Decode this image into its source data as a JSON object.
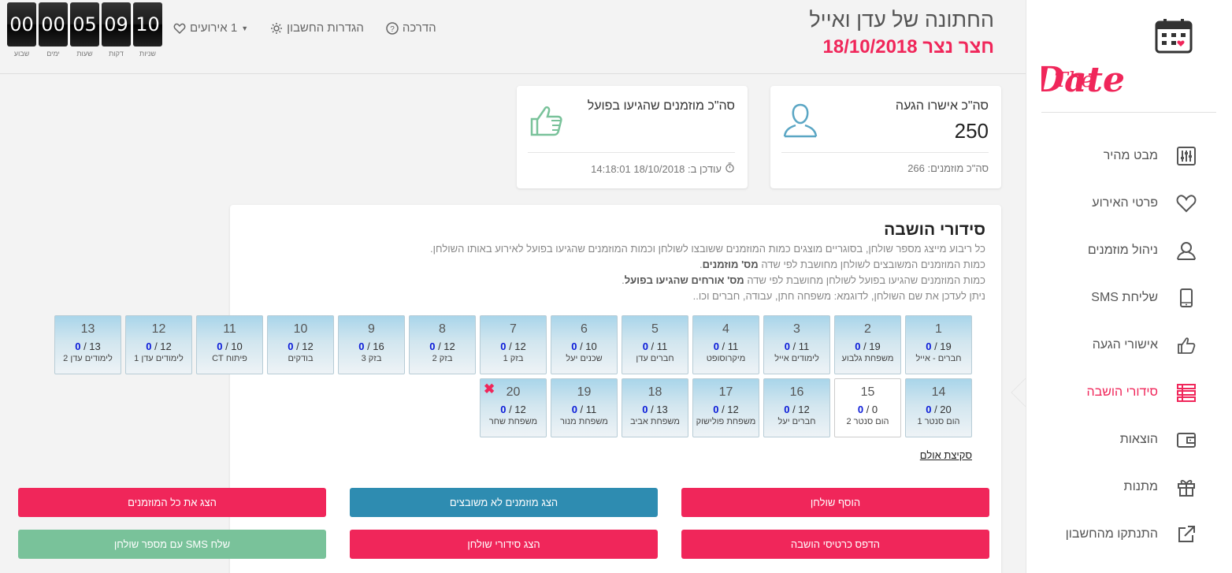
{
  "sidebar": {
    "logo_text": "Save The Date",
    "items": [
      {
        "label": "מבט מהיר",
        "icon": "sliders-icon"
      },
      {
        "label": "פרטי האירוע",
        "icon": "heart-icon"
      },
      {
        "label": "ניהול מוזמנים",
        "icon": "user-icon"
      },
      {
        "label": "שליחת SMS",
        "icon": "phone-icon"
      },
      {
        "label": "אישורי הגעה",
        "icon": "thumbs-up-icon"
      },
      {
        "label": "סידורי הושבה",
        "icon": "seating-icon",
        "active": true
      },
      {
        "label": "הוצאות",
        "icon": "wallet-icon"
      },
      {
        "label": "מתנות",
        "icon": "gift-icon"
      },
      {
        "label": "התנתקו מהחשבון",
        "icon": "external-link-icon"
      }
    ]
  },
  "header": {
    "title": "החתונה של עדן ואייל",
    "subtitle": "חצר נצר 18/10/2018",
    "nav": {
      "guide": "הדרכה",
      "settings": "הגדרות החשבון",
      "events": "1 אירועים"
    },
    "countdown": [
      {
        "value": "00",
        "label": "שבוע"
      },
      {
        "value": "00",
        "label": "ימים"
      },
      {
        "value": "05",
        "label": "שעות"
      },
      {
        "value": "09",
        "label": "דקות"
      },
      {
        "value": "10",
        "label": "שניות"
      }
    ]
  },
  "cards": {
    "rsvp": {
      "title": "סה\"כ אישרו הגעה",
      "value": "250",
      "footer": "סה\"כ מוזמנים: 266"
    },
    "arrived": {
      "title": "סה\"כ מוזמנים שהגיעו בפועל",
      "value": "",
      "footer": "עודכן ב: 18/10/2018 14:18:01"
    }
  },
  "panel": {
    "title": "סידורי הושבה",
    "desc1": "כל ריבוע מייצג מספר שולחן, בסוגריים מוצגים כמות המוזמנים ששובצו לשולחן וכמות המוזמנים שהגיעו בפועל לאירוע באותו השולחן.",
    "desc2_pre": "כמות המוזמנים המשובצים לשולחן מחושבת לפי שדה ",
    "desc2_bold": "מס' מוזמנים",
    "desc2_post": ".",
    "desc3_pre": "כמות המוזמנים שהגיעו בפועל לשולחן מחושבת לפי שדה ",
    "desc3_bold": "מס' אורחים שהגיעו בפועל",
    "desc3_post": ".",
    "desc4": "ניתן לעדכן את שם השולחן, לדוגמא: משפחה חתן, עבודה, חברים וכו..",
    "floorplan": "סקיצת אולם"
  },
  "tables_row1": [
    {
      "num": "1",
      "arrived": "0",
      "seated": "19",
      "name": "חברים - אייל"
    },
    {
      "num": "2",
      "arrived": "0",
      "seated": "19",
      "name": "משפחת גלבוע"
    },
    {
      "num": "3",
      "arrived": "0",
      "seated": "11",
      "name": "לימודים אייל"
    },
    {
      "num": "4",
      "arrived": "0",
      "seated": "11",
      "name": "מיקרוסופט"
    },
    {
      "num": "5",
      "arrived": "0",
      "seated": "11",
      "name": "חברים עדן"
    },
    {
      "num": "6",
      "arrived": "0",
      "seated": "10",
      "name": "שכנים יעל"
    },
    {
      "num": "7",
      "arrived": "0",
      "seated": "12",
      "name": "בזק 1"
    },
    {
      "num": "8",
      "arrived": "0",
      "seated": "12",
      "name": "בזק 2"
    },
    {
      "num": "9",
      "arrived": "0",
      "seated": "16",
      "name": "בזק 3"
    },
    {
      "num": "10",
      "arrived": "0",
      "seated": "12",
      "name": "בודקים"
    },
    {
      "num": "11",
      "arrived": "0",
      "seated": "10",
      "name": "פיתוח CT"
    },
    {
      "num": "12",
      "arrived": "0",
      "seated": "12",
      "name": "לימודים עדן 1"
    },
    {
      "num": "13",
      "arrived": "0",
      "seated": "13",
      "name": "לימודים עדן 2"
    }
  ],
  "tables_row2": [
    {
      "num": "14",
      "arrived": "0",
      "seated": "20",
      "name": "הום סנטר 1"
    },
    {
      "num": "15",
      "arrived": "0",
      "seated": "0",
      "name": "הום סנטר 2",
      "plain": true
    },
    {
      "num": "16",
      "arrived": "0",
      "seated": "12",
      "name": "חברים יעל"
    },
    {
      "num": "17",
      "arrived": "0",
      "seated": "12",
      "name": "משפחת פולישוק"
    },
    {
      "num": "18",
      "arrived": "0",
      "seated": "13",
      "name": "משפחת אביב"
    },
    {
      "num": "19",
      "arrived": "0",
      "seated": "11",
      "name": "משפחת מנור"
    },
    {
      "num": "20",
      "arrived": "0",
      "seated": "12",
      "name": "משפחת שחר",
      "deletable": true
    }
  ],
  "buttons": {
    "add_table": "הוסף שולחן",
    "show_unseated": "הצג מוזמנים לא משובצים",
    "show_all": "הצג את כל המוזמנים",
    "print_cards": "הדפס כרטיסי הושבה",
    "show_seating": "הצג סידורי שולחן",
    "send_sms": "שלח SMS עם מספר שולחן"
  },
  "colors": {
    "accent": "#f0265a",
    "blue_button": "#2e8cb1",
    "green_button": "#79c29a",
    "arrived_count": "#0a1ad8"
  }
}
